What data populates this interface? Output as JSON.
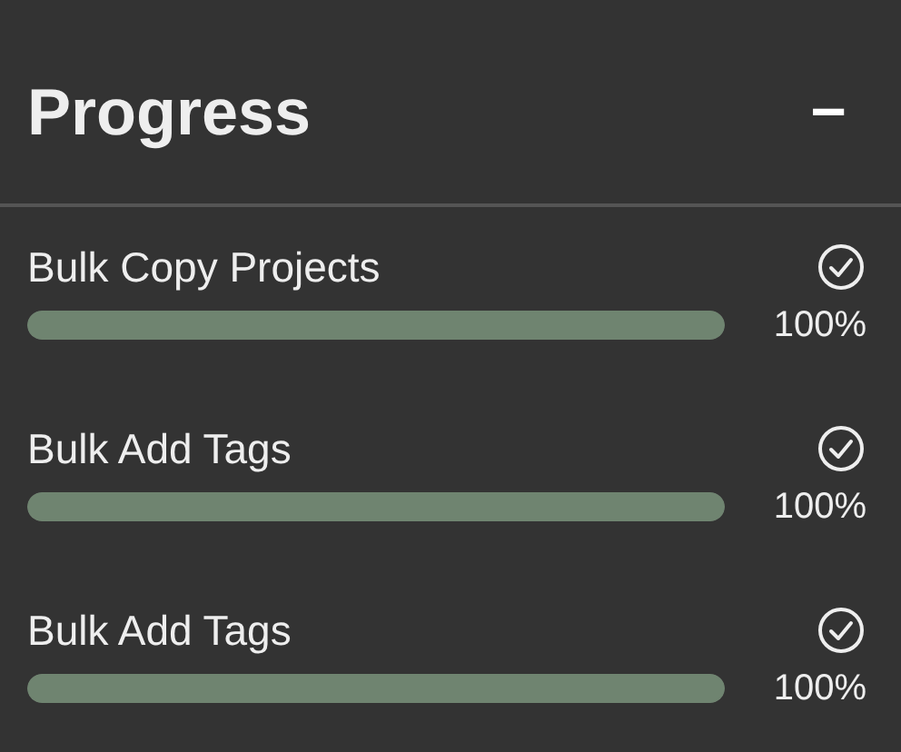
{
  "panel": {
    "title": "Progress",
    "collapse_icon": "−"
  },
  "tasks": [
    {
      "name": "Bulk Copy Projects",
      "complete": true,
      "level": 1,
      "percent": "100%"
    },
    {
      "name": "Bulk Add Tags",
      "complete": true,
      "level": 1,
      "percent": "100%"
    },
    {
      "name": "Bulk Add Tags",
      "complete": true,
      "level": 1,
      "percent": "100%"
    }
  ]
}
